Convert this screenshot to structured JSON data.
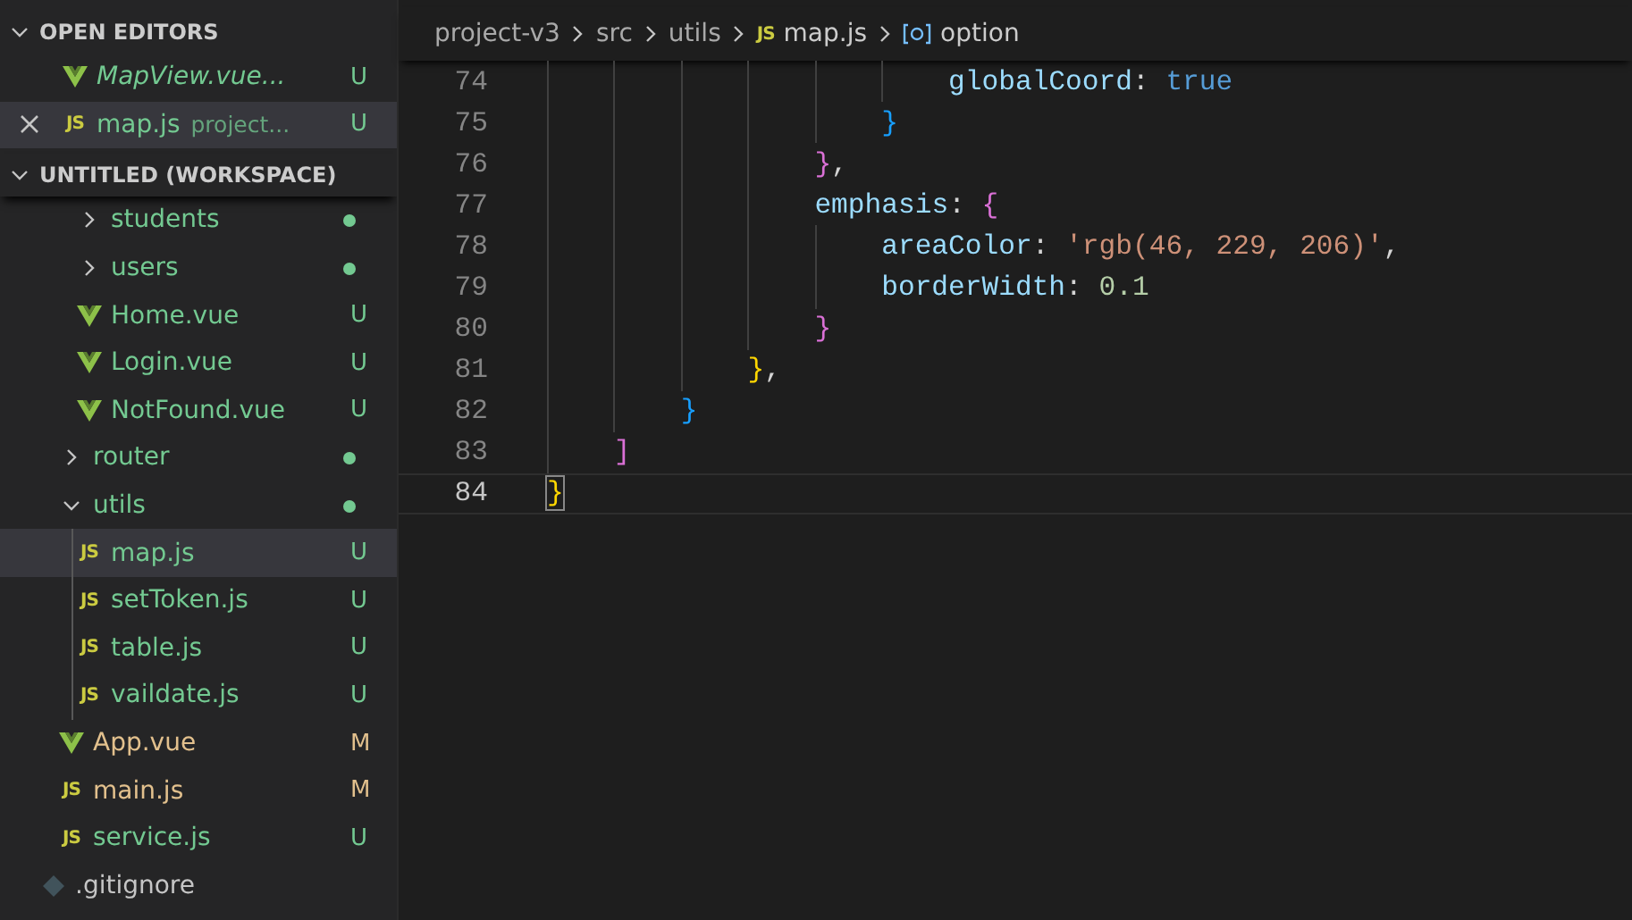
{
  "sidebar": {
    "open_editors": {
      "title": "OPEN EDITORS",
      "expanded": true,
      "items": [
        {
          "name": "MapView.vue...",
          "kind": "vue",
          "preview": true,
          "selected": false,
          "color": "#73c991",
          "badge": "U"
        },
        {
          "name": "map.js",
          "icon": "JS",
          "description": "project...",
          "kind": "js",
          "preview": false,
          "selected": true,
          "color": "#73c991",
          "badge": "U"
        }
      ]
    },
    "workspace": {
      "title": "UNTITLED (WORKSPACE)",
      "expanded": true,
      "tree": [
        {
          "children": [
            {
              "children": [
                {
                  "name": "students",
                  "kind": "folder",
                  "expanded": false,
                  "selected": false,
                  "color": "#73c991"
                },
                {
                  "name": "users",
                  "kind": "folder",
                  "expanded": false,
                  "selected": false,
                  "color": "#73c991"
                },
                {
                  "name": "Home.vue",
                  "kind": "vue",
                  "selected": false,
                  "color": "#73c991",
                  "badge": "U"
                },
                {
                  "name": "Login.vue",
                  "kind": "vue",
                  "selected": false,
                  "color": "#73c991",
                  "badge": "U"
                },
                {
                  "name": "NotFound.vue",
                  "kind": "vue",
                  "selected": false,
                  "color": "#73c991",
                  "badge": "U"
                }
              ]
            },
            {
              "name": "router",
              "kind": "folder",
              "expanded": false,
              "selected": false,
              "color": "#73c991"
            },
            {
              "name": "utils",
              "kind": "folder",
              "expanded": true,
              "selected": false,
              "color": "#73c991",
              "children": [
                {
                  "name": "map.js",
                  "icon": "JS",
                  "kind": "js",
                  "selected": true,
                  "color": "#73c991",
                  "badge": "U"
                },
                {
                  "name": "setToken.js",
                  "icon": "JS",
                  "kind": "js",
                  "selected": false,
                  "color": "#73c991",
                  "badge": "U"
                },
                {
                  "name": "table.js",
                  "icon": "JS",
                  "kind": "js",
                  "selected": false,
                  "color": "#73c991",
                  "badge": "U"
                },
                {
                  "name": "vaildate.js",
                  "icon": "JS",
                  "kind": "js",
                  "selected": false,
                  "color": "#73c991",
                  "badge": "U"
                }
              ]
            },
            {
              "name": "App.vue",
              "kind": "vue",
              "selected": false,
              "color": "#e2c08d",
              "badge": "M"
            },
            {
              "name": "main.js",
              "icon": "JS",
              "kind": "js",
              "selected": false,
              "color": "#e2c08d",
              "badge": "M"
            },
            {
              "name": "service.js",
              "icon": "JS",
              "kind": "js",
              "selected": false,
              "color": "#73c991",
              "badge": "U"
            }
          ]
        },
        {
          "name": ".gitignore",
          "kind": "git",
          "selected": false,
          "color": "#c5c5c5"
        }
      ]
    }
  },
  "breadcrumb": [
    {
      "text": "project-v3",
      "kind": "folder"
    },
    {
      "text": "src",
      "kind": "folder"
    },
    {
      "text": "utils",
      "kind": "folder"
    },
    {
      "text": "map.js",
      "icon": "JS",
      "kind": "file"
    },
    {
      "text": "option",
      "kind": "symbol"
    }
  ],
  "editor": {
    "lines": [
      {
        "children": [
          {
            "children": [
              {
                "children": [
                  {
                    "children": [
                      {
                        "children": [
                          {
                            "children": [
                              {
                                "number": "74",
                                "current": false,
                                "tokens": [
                                  {
                                    "text": "globalCoord",
                                    "kind": "prop"
                                  },
                                  {
                                    "text": ": ",
                                    "kind": "punct"
                                  },
                                  {
                                    "text": "true",
                                    "kind": "keyword"
                                  }
                                ]
                              }
                            ]
                          },
                          {
                            "number": "75",
                            "current": false,
                            "tokens": [
                              {
                                "text": "}",
                                "kind": "bracket3"
                              }
                            ]
                          }
                        ]
                      },
                      {
                        "number": "76",
                        "current": false,
                        "tokens": [
                          {
                            "text": "}",
                            "kind": "bracket2"
                          },
                          {
                            "text": ",",
                            "kind": "punct"
                          }
                        ]
                      },
                      {
                        "number": "77",
                        "current": false,
                        "tokens": [
                          {
                            "text": "emphasis",
                            "kind": "prop"
                          },
                          {
                            "text": ": ",
                            "kind": "punct"
                          },
                          {
                            "text": "{",
                            "kind": "bracket2"
                          }
                        ]
                      },
                      {
                        "children": [
                          {
                            "number": "78",
                            "current": false,
                            "tokens": [
                              {
                                "text": "areaColor",
                                "kind": "prop"
                              },
                              {
                                "text": ": ",
                                "kind": "punct"
                              },
                              {
                                "text": "'rgb(46, 229, 206)'",
                                "kind": "string"
                              },
                              {
                                "text": ",",
                                "kind": "punct"
                              }
                            ]
                          },
                          {
                            "number": "79",
                            "current": false,
                            "tokens": [
                              {
                                "text": "borderWidth",
                                "kind": "prop"
                              },
                              {
                                "text": ": ",
                                "kind": "punct"
                              },
                              {
                                "text": "0.1",
                                "kind": "number"
                              }
                            ]
                          }
                        ]
                      },
                      {
                        "number": "80",
                        "current": false,
                        "tokens": [
                          {
                            "text": "}",
                            "kind": "bracket2"
                          }
                        ]
                      }
                    ]
                  },
                  {
                    "number": "81",
                    "current": false,
                    "tokens": [
                      {
                        "text": "}",
                        "kind": "bracket1"
                      },
                      {
                        "text": ",",
                        "kind": "punct"
                      }
                    ]
                  }
                ]
              },
              {
                "number": "82",
                "current": false,
                "tokens": [
                  {
                    "text": "}",
                    "kind": "bracket3"
                  }
                ]
              }
            ]
          },
          {
            "number": "83",
            "current": false,
            "tokens": [
              {
                "text": "]",
                "kind": "bracket2"
              }
            ]
          }
        ]
      },
      {
        "number": "84",
        "current": true,
        "tokens": [
          {
            "text": "}",
            "kind": "bracket1",
            "matched": true
          }
        ]
      }
    ]
  }
}
